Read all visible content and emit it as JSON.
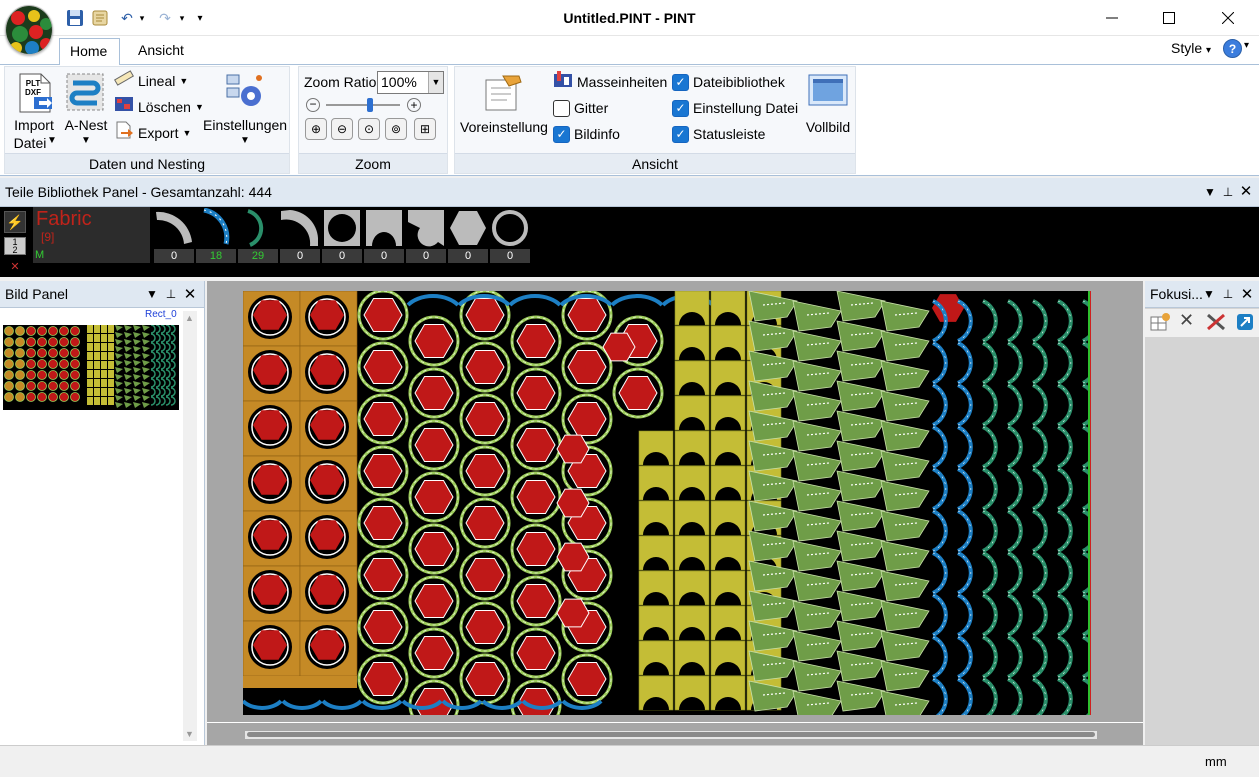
{
  "window": {
    "title": "Untitled.PINT - PINT",
    "qat_icons": [
      "save-icon",
      "scroll-icon",
      "undo-icon",
      "redo-icon",
      "customize-icon"
    ],
    "controls": [
      "minimize-icon",
      "maximize-icon",
      "close-icon"
    ]
  },
  "tabs": [
    {
      "label": "Home",
      "active": true
    },
    {
      "label": "Ansicht",
      "active": false
    }
  ],
  "style_menu": "Style",
  "help_label": "?",
  "ribbon": {
    "daten": {
      "group_label": "Daten und Nesting",
      "import_line1": "Import",
      "import_line2": "Datei",
      "import_icon_text": "PLT DXF",
      "anest": "A-Nest",
      "lineal": "Lineal",
      "loeschen": "Löschen",
      "export": "Export",
      "einstellungen": "Einstellungen"
    },
    "zoom": {
      "group_label": "Zoom",
      "ratio_label": "Zoom Ratio",
      "ratio_value": "100%",
      "slider_position": 0.6
    },
    "ansicht": {
      "group_label": "Ansicht",
      "voreinstellung": "Voreinstellung",
      "vollbild": "Vollbild",
      "checkboxes": [
        {
          "label": "Masseinheiten",
          "checked": false,
          "icon": "units-icon"
        },
        {
          "label": "Gitter",
          "checked": false
        },
        {
          "label": "Bildinfo",
          "checked": true
        },
        {
          "label": "Dateibibliothek",
          "checked": true
        },
        {
          "label": "Einstellung Datei",
          "checked": true
        },
        {
          "label": "Statusleiste",
          "checked": true
        }
      ]
    }
  },
  "library_panel": {
    "title": "Teile Bibliothek Panel - Gesamtanzahl: 444",
    "material": "Fabric",
    "material_count": "[9]",
    "unit_code": "M",
    "part_counts": [
      "0",
      "18",
      "29",
      "0",
      "0",
      "0",
      "0",
      "0",
      "0"
    ],
    "count_colors": [
      "#ffffff",
      "#33cc33",
      "#33cc33",
      "#ffffff",
      "#ffffff",
      "#ffffff",
      "#ffffff",
      "#ffffff",
      "#ffffff"
    ]
  },
  "bild_panel": {
    "title": "Bild Panel",
    "thumbnail_label": "Rect_0"
  },
  "focus_panel": {
    "title": "Fokusi..."
  },
  "status": {
    "unit": "mm"
  },
  "colors": {
    "orange": "#c58a26",
    "yellow": "#c4bd36",
    "green": "#6f9d48",
    "red": "#c01818",
    "teal": "#2a8f6a",
    "blue": "#1d7fc4"
  }
}
